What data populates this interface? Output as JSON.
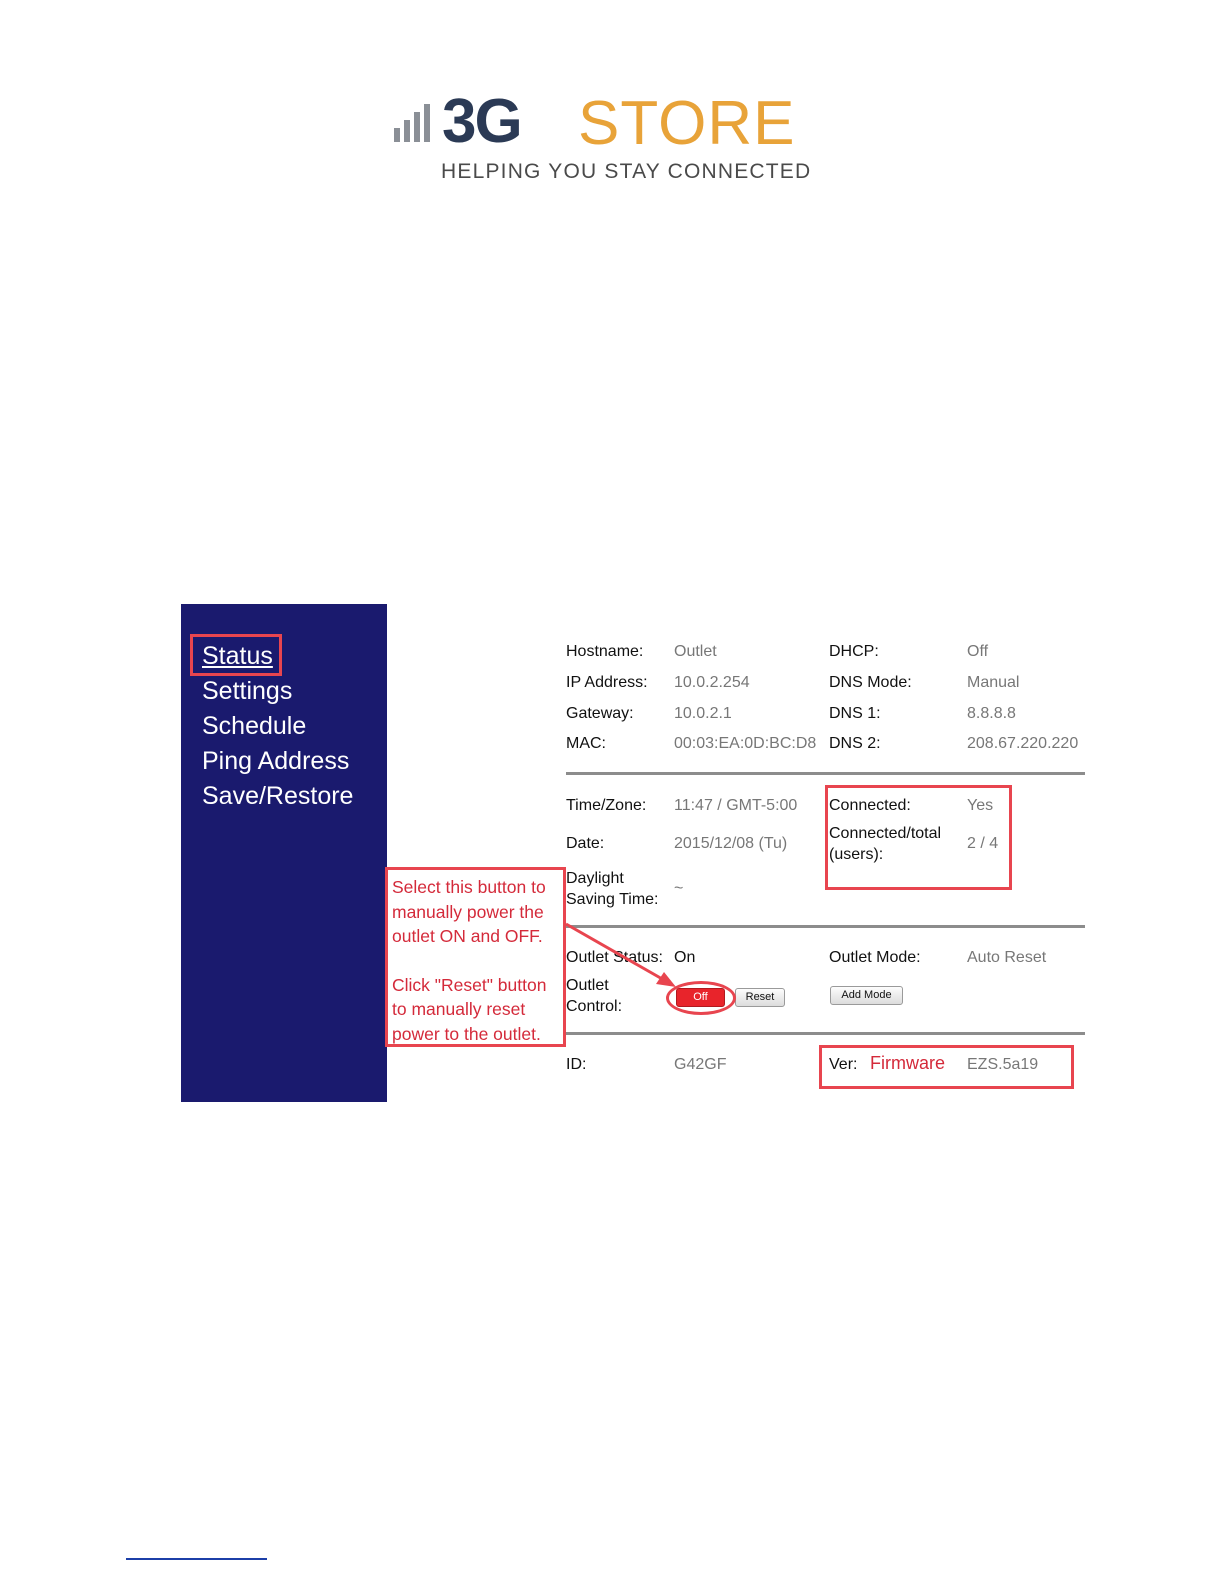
{
  "logo": {
    "brand_3g": "3G",
    "brand_store": "STORE",
    "tagline": "HELPING YOU STAY CONNECTED"
  },
  "colors": {
    "sidebar_bg": "#1a1a6e",
    "annotation_red": "#e8454f",
    "off_button": "#e8242b",
    "brand_blue": "#2b3a55",
    "brand_orange": "#e8a339"
  },
  "sidebar": {
    "items": [
      {
        "label": "Status",
        "active": true
      },
      {
        "label": "Settings"
      },
      {
        "label": "Schedule"
      },
      {
        "label": "Ping Address"
      },
      {
        "label": "Save/Restore"
      }
    ]
  },
  "network": {
    "hostname_label": "Hostname:",
    "hostname": "Outlet",
    "ip_label": "IP Address:",
    "ip": "10.0.2.254",
    "gateway_label": "Gateway:",
    "gateway": "10.0.2.1",
    "mac_label": "MAC:",
    "mac": "00:03:EA:0D:BC:D8",
    "dhcp_label": "DHCP:",
    "dhcp": "Off",
    "dns_mode_label": "DNS Mode:",
    "dns_mode": "Manual",
    "dns1_label": "DNS 1:",
    "dns1": "8.8.8.8",
    "dns2_label": "DNS 2:",
    "dns2": "208.67.220.220"
  },
  "time": {
    "timezone_label": "Time/Zone:",
    "timezone": "11:47 / GMT-5:00",
    "date_label": "Date:",
    "date": "2015/12/08 (Tu)",
    "dst_label_line1": "Daylight",
    "dst_label_line2": "Saving Time:",
    "dst": "~",
    "connected_label": "Connected:",
    "connected": "Yes",
    "users_label_line1": "Connected/total",
    "users_label_line2": "(users):",
    "users": "2 / 4"
  },
  "outlet": {
    "status_label": "Outlet Status:",
    "status": "On",
    "control_label_line1": "Outlet",
    "control_label_line2": "Control:",
    "off_button": "Off",
    "reset_button": "Reset",
    "mode_label": "Outlet Mode:",
    "mode": "Auto Reset",
    "add_mode_button": "Add Mode"
  },
  "footer_info": {
    "id_label": "ID:",
    "id": "G42GF",
    "ver_label": "Ver:",
    "firmware_annotation": "Firmware",
    "ver": "EZS.5a19"
  },
  "callout": {
    "paragraph1": "Select this button to manually power the outlet ON and OFF.",
    "paragraph2": "Click \"Reset\" button to manually reset power to the outlet."
  }
}
